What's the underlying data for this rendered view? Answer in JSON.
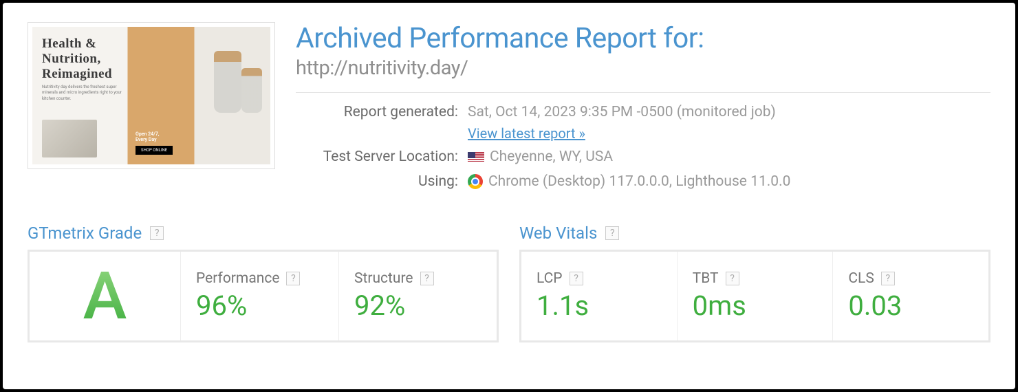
{
  "thumbnail": {
    "headline": "Health &\nNutrition,\nReimagined",
    "open_text": "Open 24/7,\nEvery Day",
    "button": "SHOP ONLINE"
  },
  "title": "Archived Performance Report for:",
  "url": "http://nutritivity.day/",
  "meta": {
    "generated_label": "Report generated:",
    "generated_value": "Sat, Oct 14, 2023 9:35 PM -0500 (monitored job)",
    "latest_link": "View latest report »",
    "location_label": "Test Server Location:",
    "location_value": "Cheyenne, WY, USA",
    "using_label": "Using:",
    "using_value": "Chrome (Desktop) 117.0.0.0, Lighthouse 11.0.0"
  },
  "grade": {
    "section_title": "GTmetrix Grade",
    "letter": "A",
    "performance_label": "Performance",
    "performance_value": "96%",
    "structure_label": "Structure",
    "structure_value": "92%"
  },
  "vitals": {
    "section_title": "Web Vitals",
    "lcp_label": "LCP",
    "lcp_value": "1.1s",
    "tbt_label": "TBT",
    "tbt_value": "0ms",
    "cls_label": "CLS",
    "cls_value": "0.03"
  },
  "help_char": "?"
}
